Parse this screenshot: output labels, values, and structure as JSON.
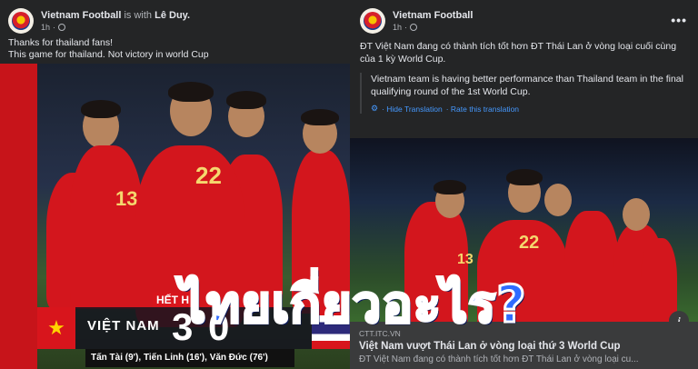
{
  "left_post": {
    "page_name": "Vietnam Football",
    "with_text": "is with",
    "tagged_user": "Lê Duy.",
    "timestamp": "1h",
    "caption_line1": "Thanks for thailand fans!",
    "caption_line2": "This game for thailand. Not victory in world Cup",
    "photo": {
      "jersey_number": "22",
      "jersey_number_2": "13",
      "banner_label": "HẾT H",
      "team_name": "VIỆT NAM",
      "score_home": "3",
      "score_away": "0",
      "scorers": "Tấn Tài (9'), Tiến Linh (16'), Văn Đức (76')"
    }
  },
  "right_post": {
    "page_name": "Vietnam Football",
    "timestamp": "1h",
    "more_label": "•••",
    "caption": "ĐT Việt Nam đang có thành tích tốt hơn ĐT Thái Lan ở vòng loại cuối cùng của 1 kỳ World Cup.",
    "translation": "Vietnam team is having better performance than Thailand team in the final qualifying round of the 1st World Cup.",
    "hide_translation": "· Hide Translation",
    "rate_translation": "· Rate this translation",
    "photo": {
      "jersey_number": "22",
      "jersey_number_2": "13"
    },
    "info_label": "i",
    "link": {
      "domain": "CTT.ITC.VN",
      "title": "Việt Nam vượt Thái Lan ở vòng loại thứ 3 World Cup",
      "description": "ĐT Việt Nam đang có thành tích tốt hơn ĐT Thái Lan ở vòng loại cu..."
    }
  },
  "overlay_caption": "ไทยเกี่ยวอะไร?",
  "colors": {
    "fb_dark": "#242526",
    "link_blue": "#4599ff",
    "jersey_red": "#d3161d",
    "overlay_blue": "#2f6bff"
  }
}
